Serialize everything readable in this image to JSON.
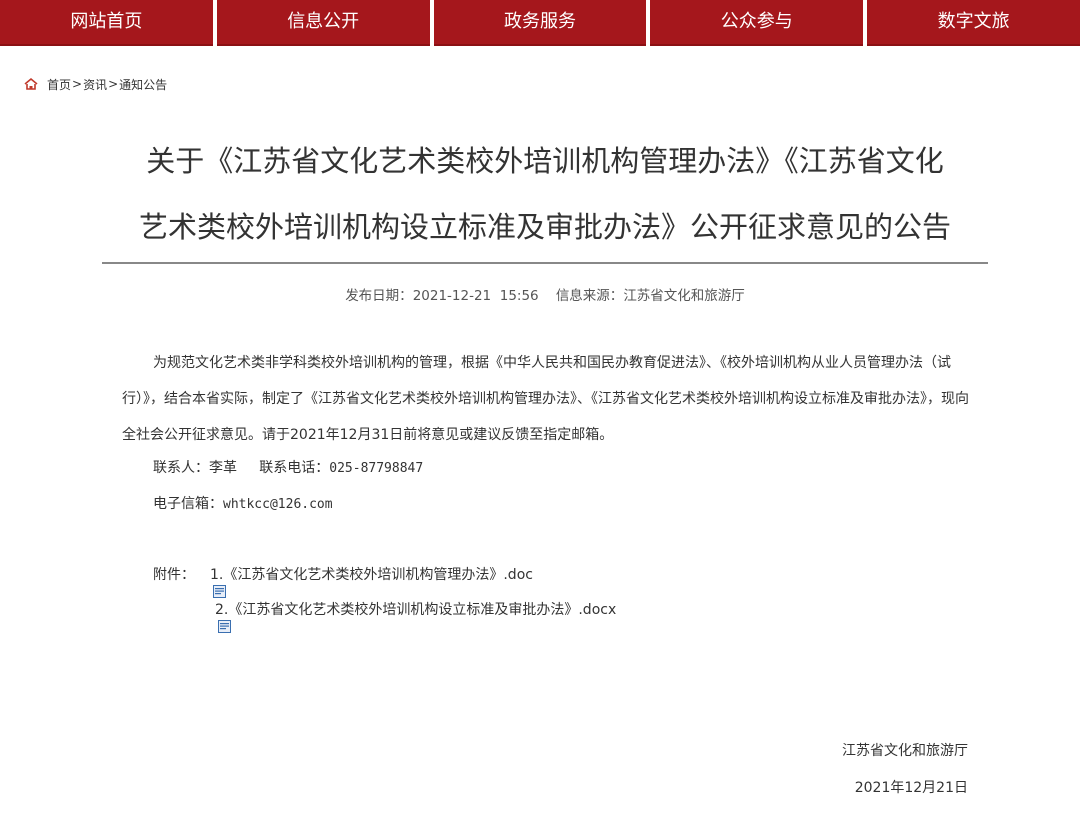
{
  "nav": {
    "items": [
      "网站首页",
      "信息公开",
      "政务服务",
      "公众参与",
      "数字文旅"
    ]
  },
  "breadcrumb": {
    "home_icon": "home-icon",
    "home": "首页",
    "separator": ">",
    "level1": "资讯",
    "level2": "通知公告"
  },
  "article": {
    "title_line1": "关于《江苏省文化艺术类校外培训机构管理办法》《江苏省文化",
    "title_line2": "艺术类校外培训机构设立标准及审批办法》公开征求意见的公告",
    "publish_label": "发布日期：",
    "publish_date": "2021-12-21  15:56",
    "source_label": "信息来源：",
    "source": "江苏省文化和旅游厅",
    "paragraph": "为规范文化艺术类非学科类校外培训机构的管理，根据《中华人民共和国民办教育促进法》、《校外培训机构从业人员管理办法（试行）》，结合本省实际，制定了《江苏省文化艺术类校外培训机构管理办法》、《江苏省文化艺术类校外培训机构设立标准及审批办法》，现向全社会公开征求意见。请于2021年12月31日前将意见或建议反馈至指定邮箱。",
    "contact_label": "联系人：",
    "contact_name": "李革",
    "phone_label": "联系电话：",
    "phone": "025-87798847",
    "email_label": "电子信箱：",
    "email": "whtkcc@126.com",
    "attachments_label": "附件：",
    "attachments": [
      "1.《江苏省文化艺术类校外培训机构管理办法》.doc",
      "2.《江苏省文化艺术类校外培训机构设立标准及审批办法》.docx"
    ],
    "signature_org": "江苏省文化和旅游厅",
    "signature_date": "2021年12月21日"
  },
  "colors": {
    "nav_bg": "#a5171c",
    "breadcrumb_icon": "#c0392b",
    "doc_icon": "#3a6fb0"
  }
}
